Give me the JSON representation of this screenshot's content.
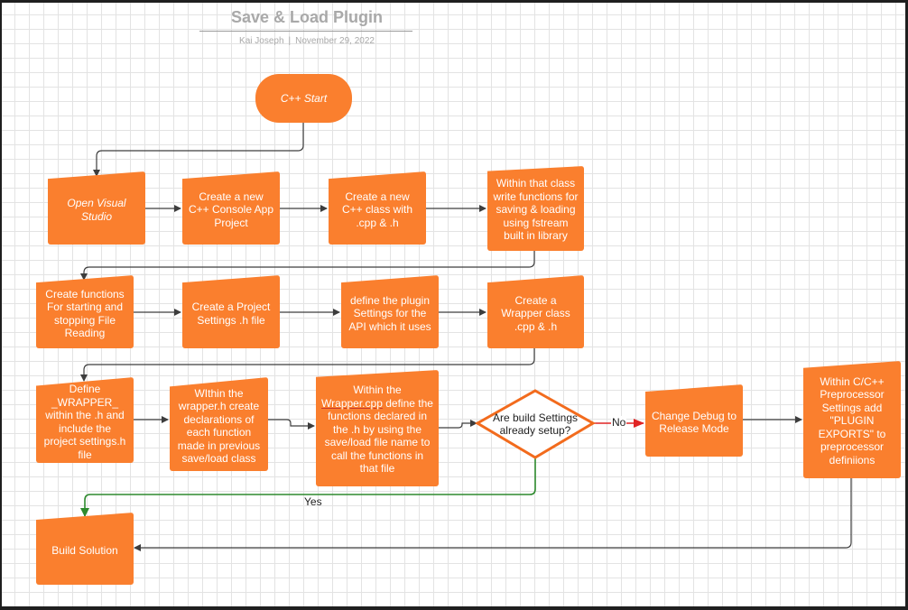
{
  "header": {
    "title": "Save & Load Plugin",
    "author": "Kai Joseph",
    "separator": "|",
    "date": "November 29, 2022"
  },
  "nodes": {
    "start": "C++ Start",
    "open_vs": "Open Visual Studio",
    "console_app": "Create a new C++ Console App Project",
    "class_cpp_h": "Create a new C++ class with .cpp & .h",
    "fstream_functions": "Within that class write functions for saving & loading using fstream built in library",
    "start_stop_functions": "Create functions For starting and stopping File Reading",
    "project_settings": "Create a Project Settings .h file",
    "plugin_settings": "define the plugin Settings for the API which it uses",
    "wrapper_class": "Create a Wrapper class .cpp & .h",
    "define_wrapper": "Define _WRAPPER_ within the .h and include the project settings.h file",
    "wrapper_declarations": "WIthin the wrapper.h create declarations of each function made in previous save/load class",
    "wrapper_cpp_prefix": "Within the ",
    "wrapper_cpp_link": "Wrapper.cpp",
    "wrapper_cpp_rest": "define the functions declared in the .h by using the save/load file name to call the functions in that file",
    "decision": "Are build Settings already setup?",
    "release_mode": "Change Debug to Release Mode",
    "preprocessor": "Within C/C++ Preprocessor Settings add \"PLUGIN EXPORTS\" to preprocessor definiions",
    "build": "Build Solution"
  },
  "edge_labels": {
    "no": "No",
    "yes": "Yes"
  },
  "colors": {
    "node_fill": "#fa7f2e",
    "decision_stroke": "#f26b1d",
    "connector": "#3d3d3d",
    "no_connector": "#e02424",
    "yes_connector": "#2e8a2e",
    "grid": "#e3e3e3"
  }
}
